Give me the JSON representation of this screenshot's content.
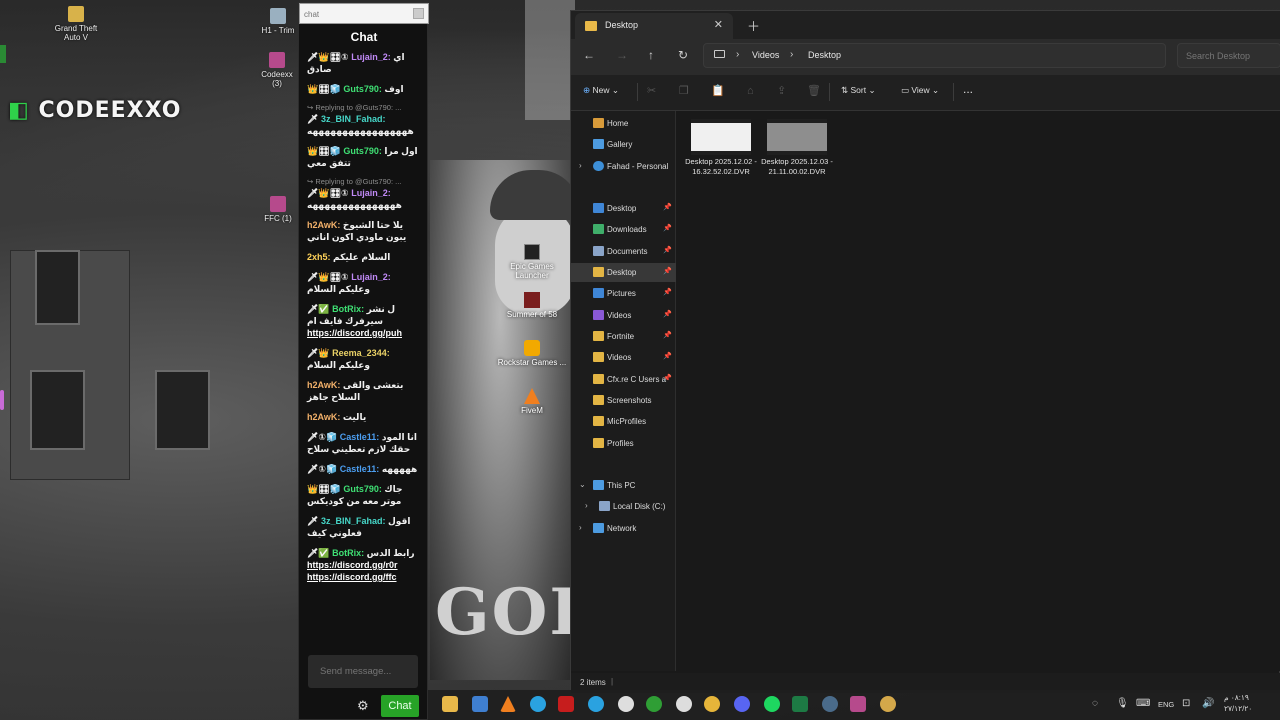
{
  "desktop": {
    "logo_text": "CODEEXXO",
    "icons": [
      {
        "label": "Grand Theft Auto V",
        "color": "#d8b24a"
      },
      {
        "label": "H1 - Trim",
        "color": "#9ab0c0"
      },
      {
        "label": "Codeexx (3)",
        "color": "#b64a8c"
      },
      {
        "label": "FFC (1)",
        "color": "#b64a8c"
      }
    ],
    "mid_icons": [
      {
        "label": "Epic Games Launcher",
        "color": "#222222"
      },
      {
        "label": "Summer of 58",
        "color": "#7a1e1e"
      },
      {
        "label": "Rockstar Games ...",
        "color": "#f2a900"
      },
      {
        "label": "FiveM",
        "color": "#f07f1f"
      }
    ]
  },
  "chat": {
    "search_placeholder": "chat",
    "title": "Chat",
    "send_placeholder": "Send message...",
    "send_label": "Chat",
    "messages": [
      {
        "badges": "🗡👑🎛①",
        "user": "Lujain_2:",
        "user_color": "u-purple",
        "text": "اي صادق",
        "reply": "",
        "link": ""
      },
      {
        "badges": "👑🎛🧊",
        "user": "Guts790:",
        "user_color": "u-green",
        "text": "اوف",
        "reply": "",
        "link": ""
      },
      {
        "badges": "🗡",
        "user": "3z_BIN_Fahad:",
        "user_color": "u-teal",
        "text": "هههههههههههههههههه",
        "reply": "↪ Replying to @Guts790: ...",
        "link": ""
      },
      {
        "badges": "👑🎛🧊",
        "user": "Guts790:",
        "user_color": "u-green",
        "text": "اول مرا تتفق معي",
        "reply": "",
        "link": ""
      },
      {
        "badges": "🗡👑🎛①",
        "user": "Lujain_2:",
        "user_color": "u-purple",
        "text": "هههههههههههههههه",
        "reply": "↪ Replying to @Guts790: ...",
        "link": ""
      },
      {
        "badges": "",
        "user": "h2AwK:",
        "user_color": "u-orange",
        "text": "يلا حتا الشيوخ يبون ماودي اكون اناني",
        "reply": "",
        "link": ""
      },
      {
        "badges": "",
        "user": "2xh5:",
        "user_color": "u-gold",
        "text": "السلام عليكم",
        "reply": "",
        "link": ""
      },
      {
        "badges": "🗡👑🎛①",
        "user": "Lujain_2:",
        "user_color": "u-purple",
        "text": "وعليكم السلام",
        "reply": "",
        "link": ""
      },
      {
        "badges": "🗡✅",
        "user": "BotRix:",
        "user_color": "u-green",
        "text": "ل نشر سيرفرك فايف ام",
        "reply": "",
        "link": "https://discord.gg/puh"
      },
      {
        "badges": "🗡👑",
        "user": "Reema_2344:",
        "user_color": "u-yellow",
        "text": "وعليكم السلام",
        "reply": "",
        "link": ""
      },
      {
        "badges": "",
        "user": "h2AwK:",
        "user_color": "u-orange",
        "text": "بتعشى والقى السلاح جاهز",
        "reply": "",
        "link": ""
      },
      {
        "badges": "",
        "user": "h2AwK:",
        "user_color": "u-orange",
        "text": "ياليت",
        "reply": "",
        "link": ""
      },
      {
        "badges": "🗡①🧊",
        "user": "Castle11:",
        "user_color": "u-blue",
        "text": "انا المود حقك لازم تعطيني سلاح",
        "reply": "",
        "link": ""
      },
      {
        "badges": "🗡①🧊",
        "user": "Castle11:",
        "user_color": "u-blue",
        "text": "هههههه",
        "reply": "",
        "link": ""
      },
      {
        "badges": "👑🎛🧊",
        "user": "Guts790:",
        "user_color": "u-green",
        "text": "جاك موتر معه من كوديكس",
        "reply": "",
        "link": ""
      },
      {
        "badges": "🗡",
        "user": "3z_BIN_Fahad:",
        "user_color": "u-teal",
        "text": "اقول فعلوني كيف",
        "reply": "",
        "link": ""
      },
      {
        "badges": "🗡✅",
        "user": "BotRix:",
        "user_color": "u-green",
        "text": "رابط الدس",
        "reply": "",
        "link": "https://discord.gg/r0r https://discord.gg/ffc"
      }
    ]
  },
  "explorer": {
    "tab_title": "Desktop",
    "breadcrumb": [
      "Videos",
      "Desktop"
    ],
    "search_placeholder": "Search Desktop",
    "toolbar": {
      "new": "New",
      "sort": "Sort",
      "view": "View",
      "more": "..."
    },
    "nav_items": [
      {
        "label": "Home",
        "color": "#d89b3a",
        "pinned": false,
        "chevron": false,
        "selected": false
      },
      {
        "label": "Gallery",
        "color": "#4d9be0",
        "pinned": false,
        "chevron": false,
        "selected": false
      },
      {
        "label": "Fahad - Personal",
        "color": "#3d8fd8",
        "pinned": false,
        "chevron": true,
        "selected": false
      },
      {
        "label": "Desktop",
        "color": "#3f86d6",
        "pinned": true,
        "chevron": false,
        "selected": false
      },
      {
        "label": "Downloads",
        "color": "#3fae6a",
        "pinned": true,
        "chevron": false,
        "selected": false
      },
      {
        "label": "Documents",
        "color": "#8aa4c8",
        "pinned": true,
        "chevron": false,
        "selected": false
      },
      {
        "label": "Desktop",
        "color": "#e3b544",
        "pinned": true,
        "chevron": false,
        "selected": true
      },
      {
        "label": "Pictures",
        "color": "#3f86d6",
        "pinned": true,
        "chevron": false,
        "selected": false
      },
      {
        "label": "Videos",
        "color": "#8a59d6",
        "pinned": true,
        "chevron": false,
        "selected": false
      },
      {
        "label": "Fortnite",
        "color": "#e3b544",
        "pinned": true,
        "chevron": false,
        "selected": false
      },
      {
        "label": "Videos",
        "color": "#e3b544",
        "pinned": true,
        "chevron": false,
        "selected": false
      },
      {
        "label": "Cfx.re  C  Users a",
        "color": "#e3b544",
        "pinned": true,
        "chevron": false,
        "selected": false
      },
      {
        "label": "Screenshots",
        "color": "#e3b544",
        "pinned": false,
        "chevron": false,
        "selected": false
      },
      {
        "label": "MicProfiles",
        "color": "#e3b544",
        "pinned": false,
        "chevron": false,
        "selected": false
      },
      {
        "label": "Profiles",
        "color": "#e3b544",
        "pinned": false,
        "chevron": false,
        "selected": false
      },
      {
        "label": "This PC",
        "color": "#4d9be0",
        "pinned": false,
        "chevron": true,
        "selected": false
      },
      {
        "label": "Local Disk (C:)",
        "color": "#8aa4c8",
        "pinned": false,
        "chevron": true,
        "selected": false
      },
      {
        "label": "Network",
        "color": "#4d9be0",
        "pinned": false,
        "chevron": true,
        "selected": false
      }
    ],
    "files": [
      {
        "name": "Desktop 2025.12.02 - 16.32.52.02.DVR",
        "thumb": "#f0f0f0"
      },
      {
        "name": "Desktop 2025.12.03 - 21.11.00.02.DVR",
        "thumb": "#8e8e8e"
      }
    ],
    "status_count": "2 items",
    "status_sep": "|"
  },
  "taskbar": {
    "apps": [
      {
        "name": "file-explorer",
        "color": "#e8b84a"
      },
      {
        "name": "store",
        "color": "#3f7fd0"
      },
      {
        "name": "launcher-a",
        "color": "#f07f1f"
      },
      {
        "name": "telegram",
        "color": "#2aa2e0"
      },
      {
        "name": "netflix",
        "color": "#c61d1d"
      },
      {
        "name": "telegram-2",
        "color": "#2aa2e0"
      },
      {
        "name": "rockstar",
        "color": "#dedede"
      },
      {
        "name": "xbox",
        "color": "#2f9e35"
      },
      {
        "name": "sync",
        "color": "#dddddd"
      },
      {
        "name": "chat-app",
        "color": "#e6b53a"
      },
      {
        "name": "discord",
        "color": "#5865f2"
      },
      {
        "name": "spotify",
        "color": "#1ed760"
      },
      {
        "name": "excel",
        "color": "#1d7a44"
      },
      {
        "name": "steam",
        "color": "#4a6b8a"
      },
      {
        "name": "winrar",
        "color": "#b64a8c"
      },
      {
        "name": "extra",
        "color": "#d4a84a"
      }
    ],
    "lang": "ENG",
    "time": "٠٨:١٩ م",
    "date": "٢٧/١٢/٢٠"
  }
}
